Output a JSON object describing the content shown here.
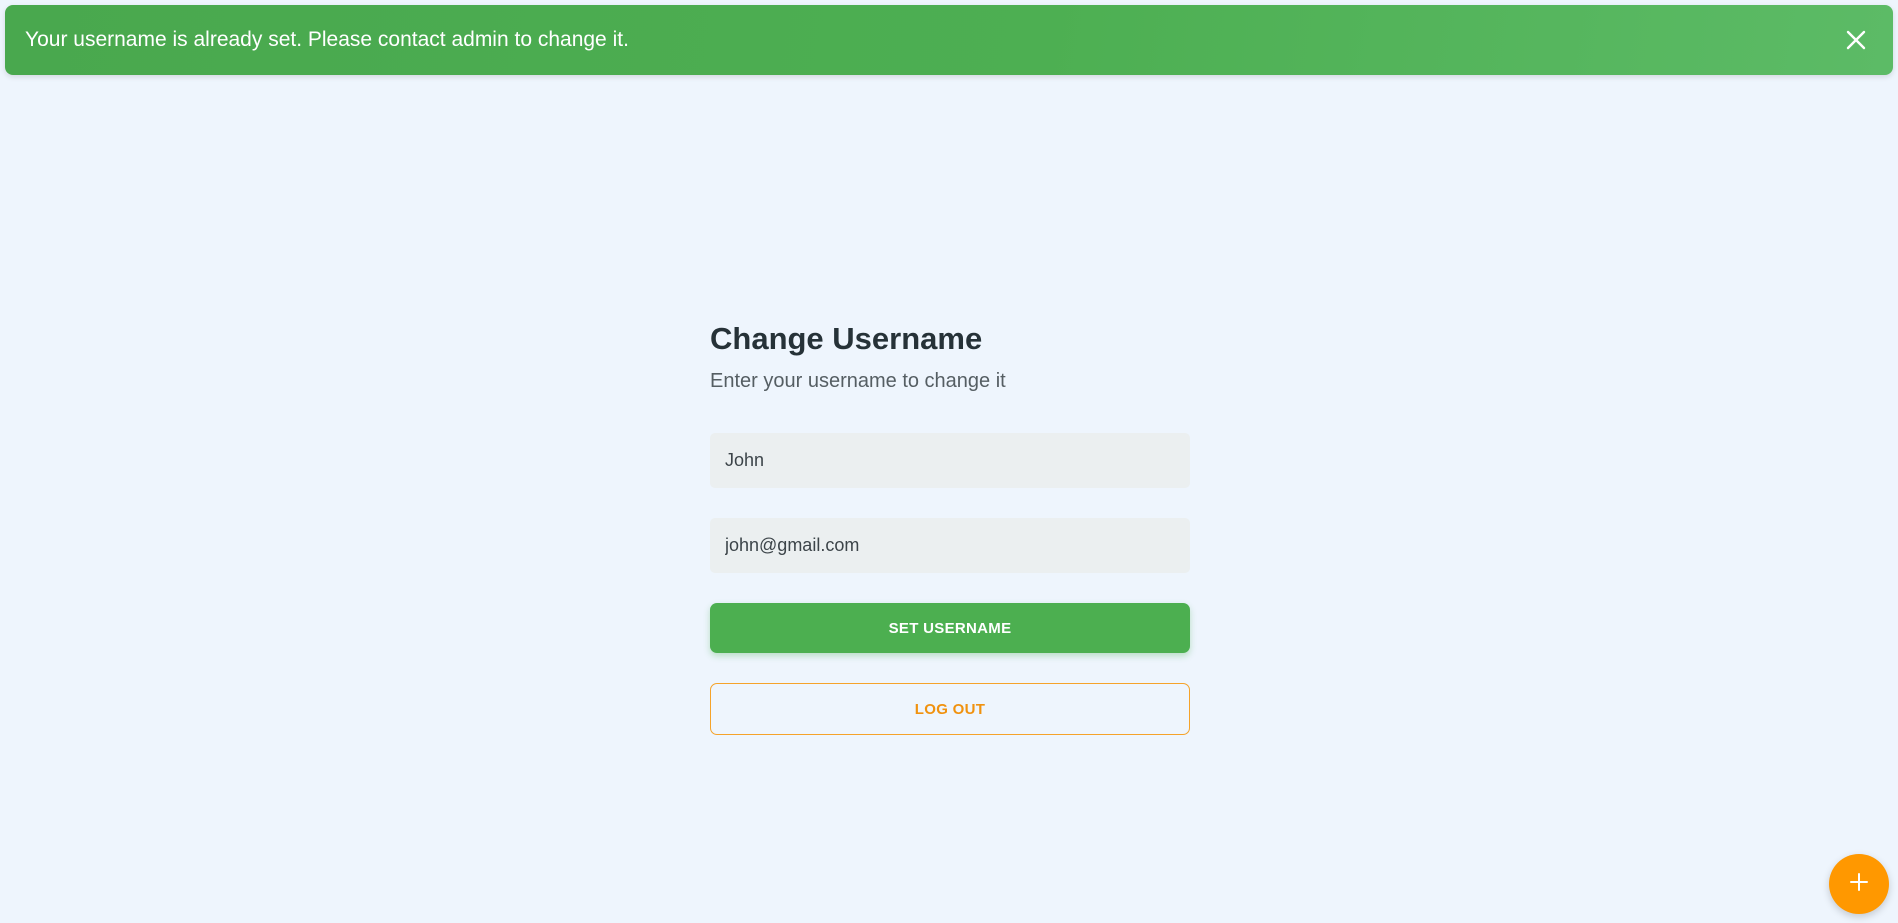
{
  "notification": {
    "message": "Your username is already set. Please contact admin to change it.",
    "close_icon": "close-icon",
    "color": "#4caf50"
  },
  "form": {
    "title": "Change Username",
    "subtitle": "Enter your username to change it",
    "username_value": "John",
    "email_value": "john@gmail.com",
    "submit_label": "SET USERNAME",
    "logout_label": "LOG OUT"
  },
  "fab": {
    "icon": "plus-icon",
    "color": "#ff9800"
  },
  "colors": {
    "background": "#eef5fd",
    "primary": "#4caf50",
    "accent": "#ff9800"
  }
}
